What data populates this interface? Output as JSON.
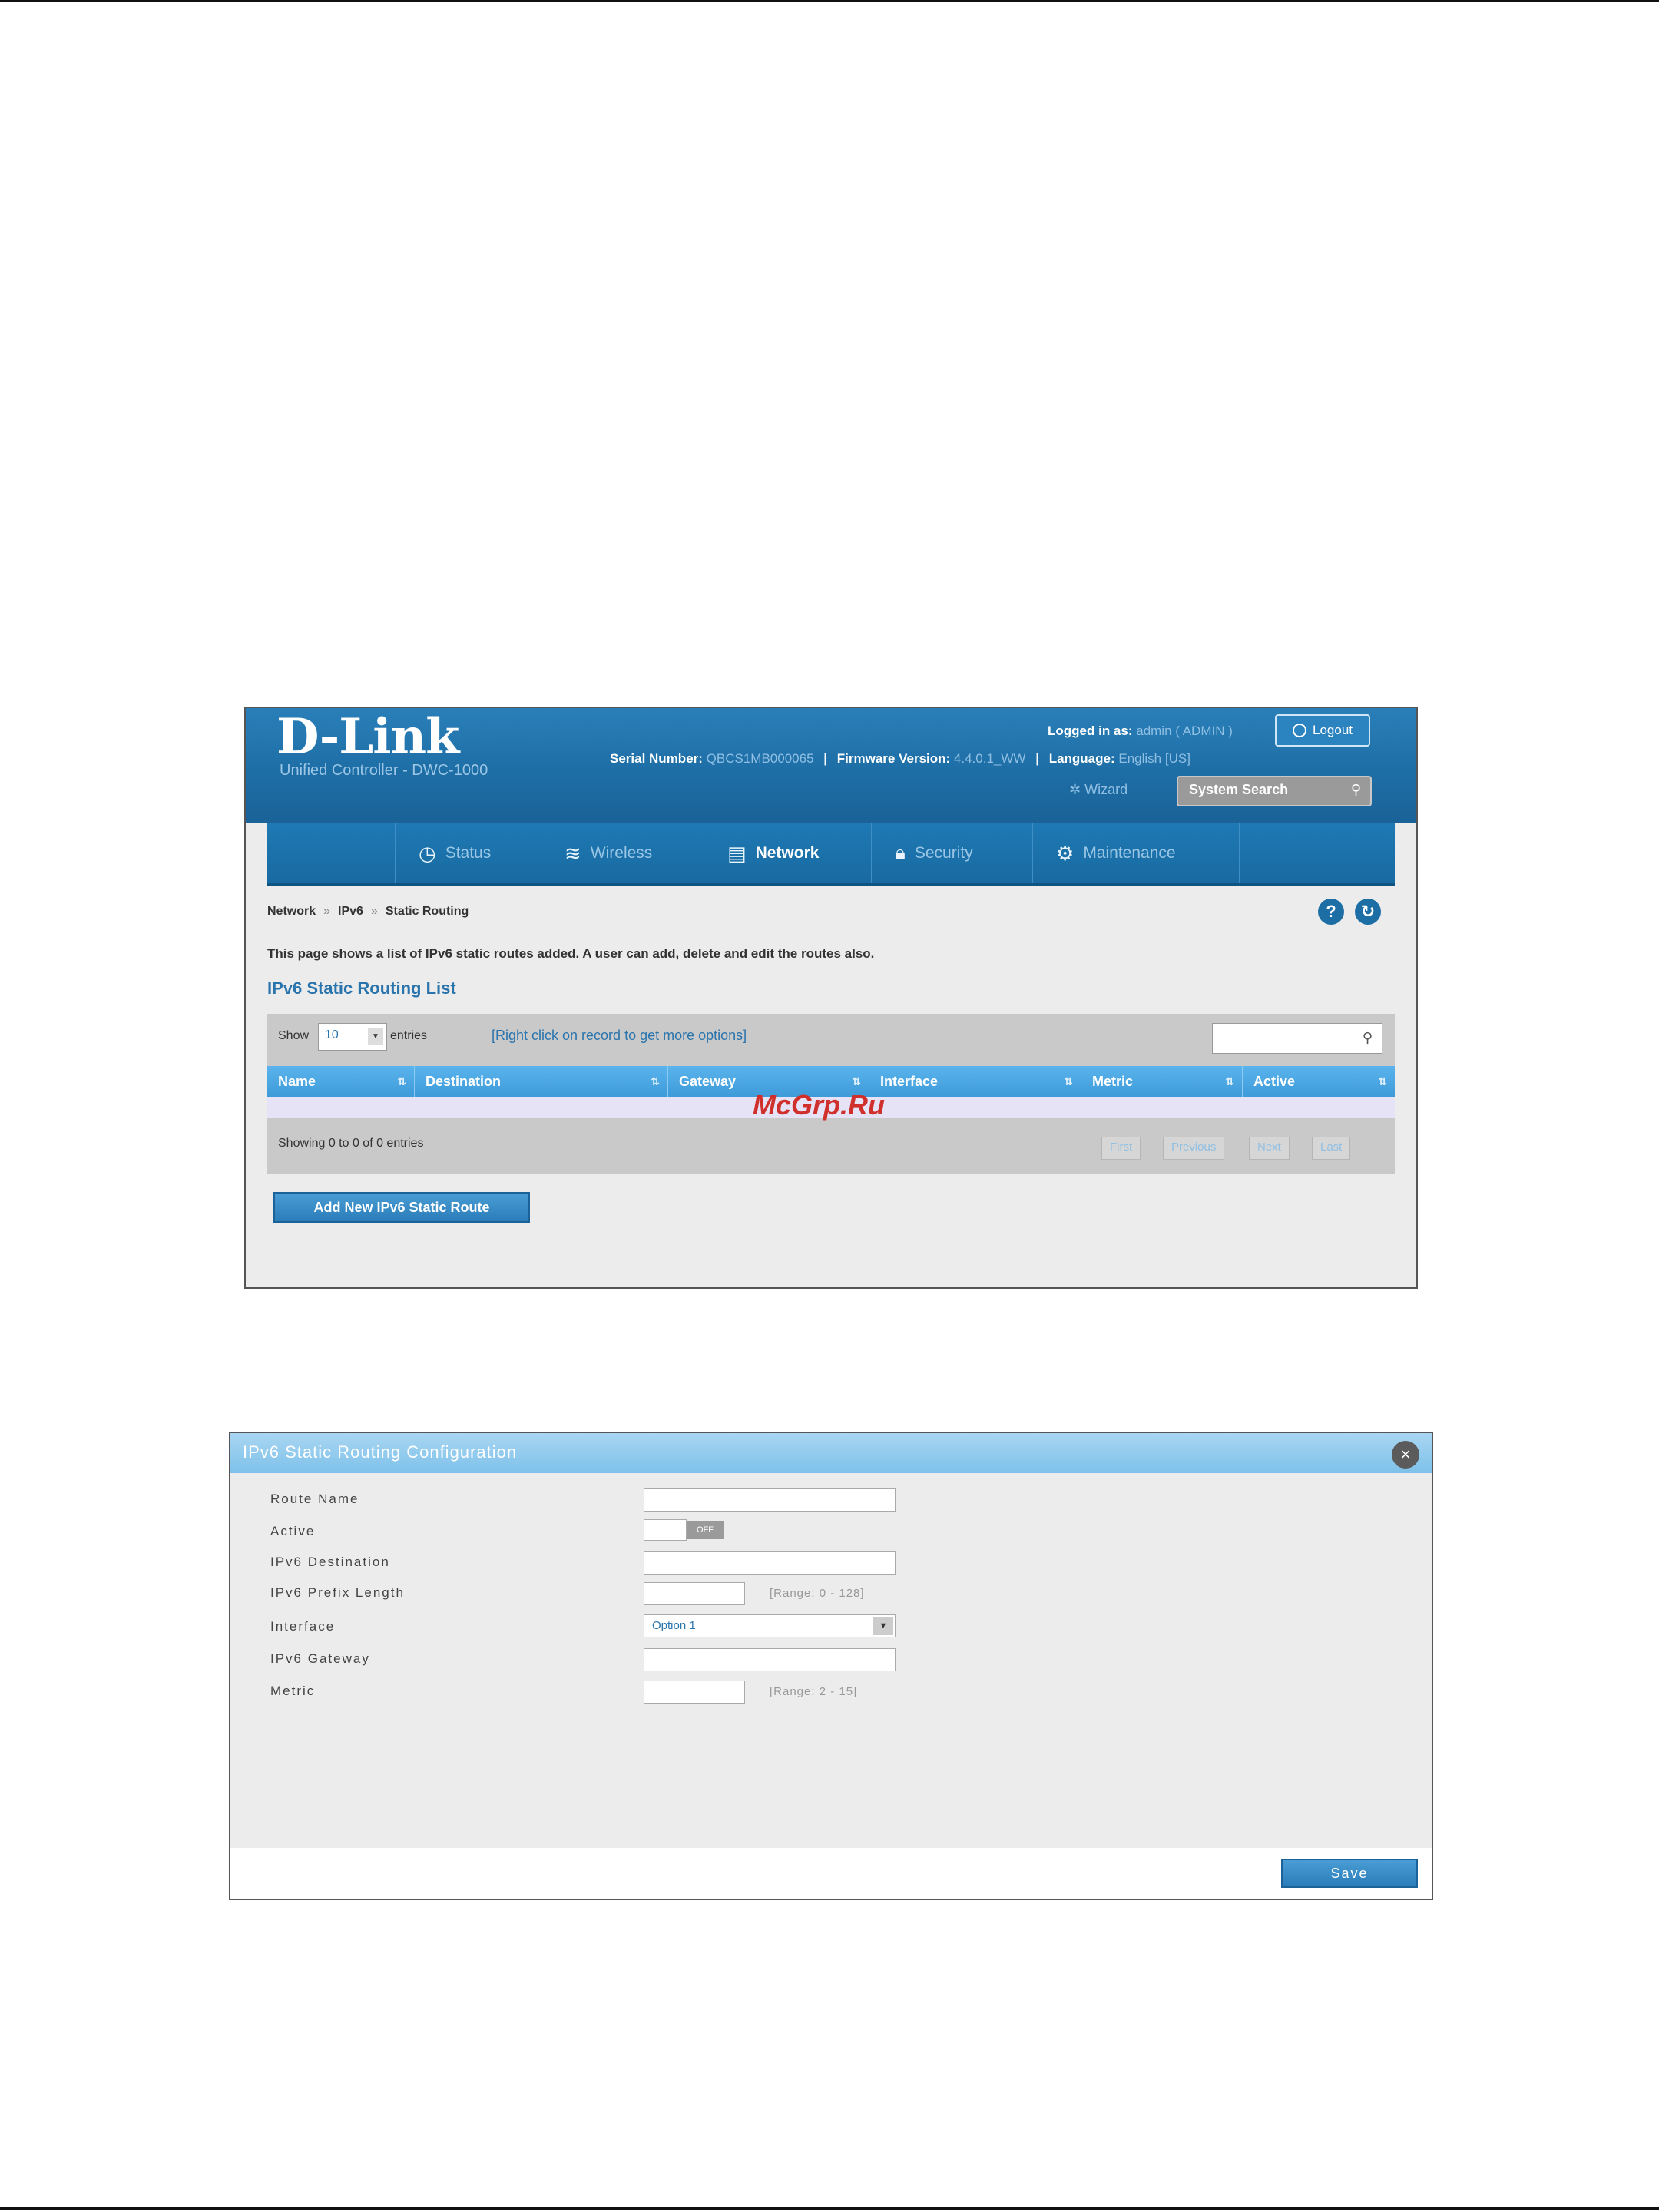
{
  "router": {
    "logo": "D-Link",
    "subtitle": "Unified Controller - DWC-1000",
    "serial_label": "Serial Number:",
    "serial_value": "QBCS1MB000065",
    "firmware_label": "Firmware Version:",
    "firmware_value": "4.4.0.1_WW",
    "language_label": "Language:",
    "language_value": "English [US]",
    "logged_label": "Logged in as:",
    "logged_value": "admin ( ADMIN )",
    "logout_label": "Logout",
    "wizard_label": "Wizard",
    "system_search_placeholder": "System Search",
    "nav": [
      {
        "label": "Status",
        "icon": "gauge-icon",
        "glyph": "◷"
      },
      {
        "label": "Wireless",
        "icon": "wifi-icon",
        "glyph": "≋"
      },
      {
        "label": "Network",
        "icon": "network-icon",
        "glyph": "▤"
      },
      {
        "label": "Security",
        "icon": "lock-icon",
        "glyph": "🔒︎"
      },
      {
        "label": "Maintenance",
        "icon": "gear-icon",
        "glyph": "⚙"
      }
    ],
    "active_nav": "Network",
    "breadcrumb": [
      "Network",
      "IPv6",
      "Static Routing"
    ],
    "description": "This page shows a list of IPv6 static routes added. A user can add, delete and edit the routes also.",
    "list_title": "IPv6 Static Routing List",
    "show_label": "Show",
    "show_value": "10",
    "entries_label": "entries",
    "hint": "[Right click on record to get more options]",
    "columns": [
      "Name",
      "Destination",
      "Gateway",
      "Interface",
      "Metric",
      "Active"
    ],
    "showing": "Showing 0 to 0 of 0 entries",
    "pagination": [
      "First",
      "Previous",
      "Next",
      "Last"
    ],
    "add_button": "Add New IPv6 Static Route"
  },
  "watermark": "McGrp.Ru",
  "dialog": {
    "title": "IPv6 Static Routing Configuration",
    "close_glyph": "×",
    "fields": {
      "route_name": "Route Name",
      "active": "Active",
      "destination": "IPv6 Destination",
      "prefix_length": "IPv6 Prefix Length",
      "interface": "Interface",
      "gateway": "IPv6 Gateway",
      "metric": "Metric"
    },
    "toggle_off": "OFF",
    "prefix_range": "[Range: 0 - 128]",
    "metric_range": "[Range: 2 - 15]",
    "interface_value": "Option 1",
    "save": "Save"
  },
  "colors": {
    "header_blue": "#1e6ea6",
    "table_header": "#3e9bd9",
    "link_blue": "#2a74ad",
    "watermark": "#d0302c"
  }
}
